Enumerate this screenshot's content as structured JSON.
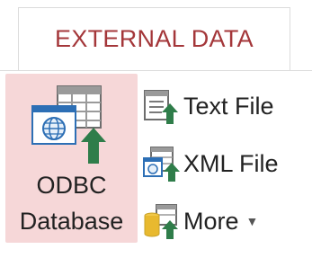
{
  "ribbon_tab": {
    "label": "EXTERNAL DATA"
  },
  "odbc": {
    "label_line1": "ODBC",
    "label_line2": "Database",
    "icon": "odbc-database-icon"
  },
  "commands": {
    "text_file": {
      "label": "Text File",
      "icon": "text-file-import-icon"
    },
    "xml_file": {
      "label": "XML File",
      "icon": "xml-file-import-icon"
    },
    "more": {
      "label": "More",
      "icon": "more-import-icon",
      "dropdown": "chevron-down-icon"
    }
  },
  "colors": {
    "accent_text": "#a4373a",
    "odbc_highlight": "#f6d7d8",
    "import_arrow": "#2f7d4a"
  }
}
